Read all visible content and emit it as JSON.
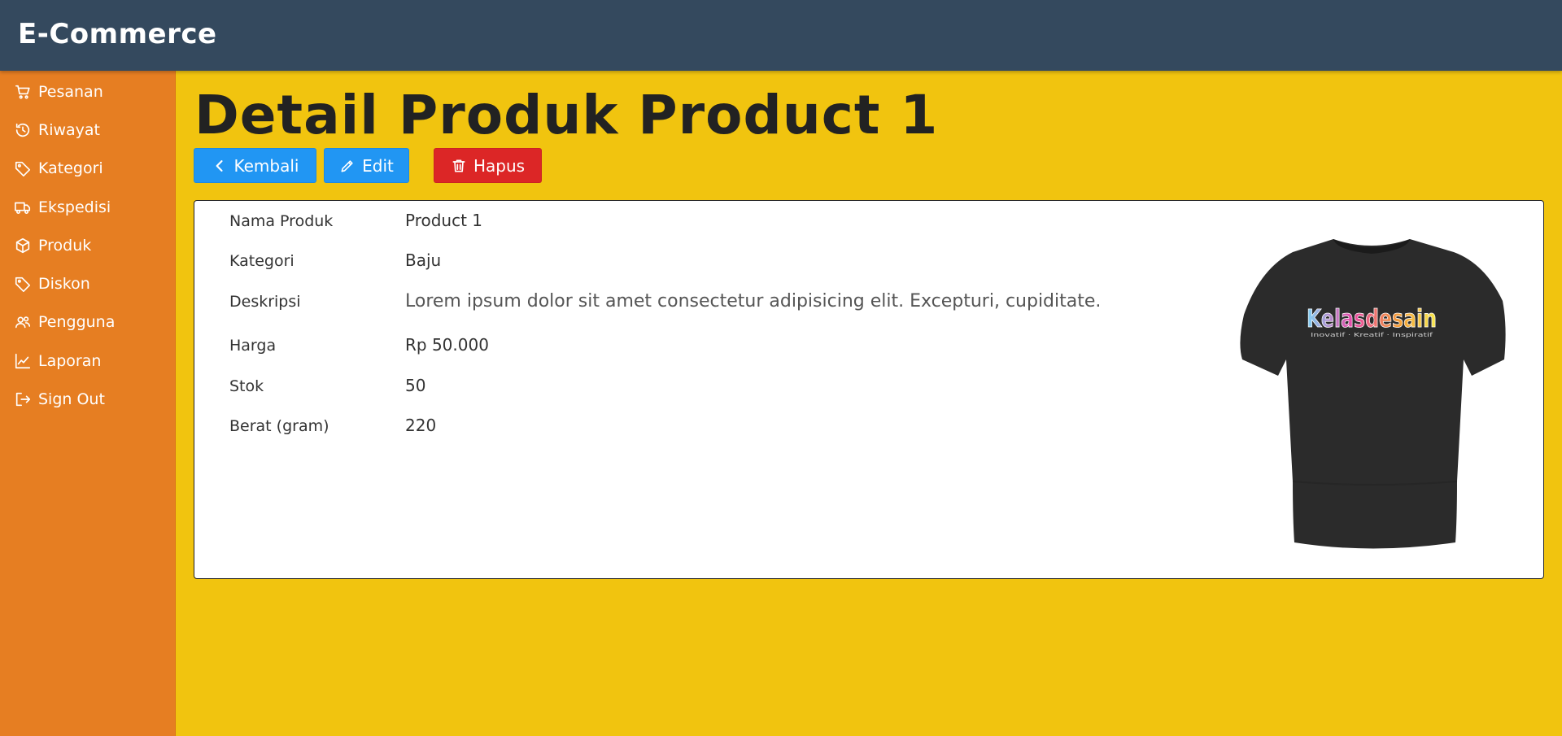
{
  "app": {
    "title": "E-Commerce"
  },
  "sidebar": {
    "items": [
      {
        "label": "Pesanan",
        "icon": "cart-icon"
      },
      {
        "label": "Riwayat",
        "icon": "history-icon"
      },
      {
        "label": "Kategori",
        "icon": "tag-icon"
      },
      {
        "label": "Ekspedisi",
        "icon": "truck-icon"
      },
      {
        "label": "Produk",
        "icon": "box-icon"
      },
      {
        "label": "Diskon",
        "icon": "tag-icon"
      },
      {
        "label": "Pengguna",
        "icon": "users-icon"
      },
      {
        "label": "Laporan",
        "icon": "chart-icon"
      },
      {
        "label": "Sign Out",
        "icon": "sign-out-icon"
      }
    ]
  },
  "page": {
    "title": "Detail Produk Product 1",
    "buttons": {
      "back": "Kembali",
      "edit": "Edit",
      "delete": "Hapus"
    }
  },
  "product": {
    "fields": [
      {
        "label": "Nama Produk",
        "value": "Product 1"
      },
      {
        "label": "Kategori",
        "value": "Baju"
      },
      {
        "label": "Deskripsi",
        "value": "Lorem ipsum dolor sit amet consectetur adipisicing elit. Excepturi, cupiditate."
      },
      {
        "label": "Harga",
        "value": "Rp 50.000"
      },
      {
        "label": "Stok",
        "value": "50"
      },
      {
        "label": "Berat (gram)",
        "value": "220"
      }
    ],
    "image": {
      "logo_text": "Kelasdesain",
      "logo_tagline": "Inovatif · Kreatif · Inspiratif"
    }
  },
  "colors": {
    "topbar": "#34495e",
    "sidebar": "#e67e22",
    "main": "#f1c40f",
    "primary": "#2196f3",
    "danger": "#dc2626"
  }
}
